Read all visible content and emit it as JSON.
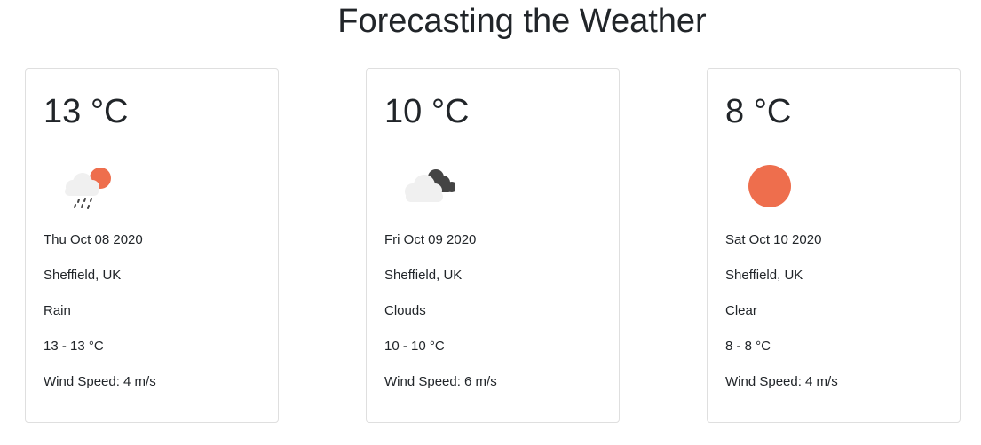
{
  "page": {
    "title": "Forecasting the Weather"
  },
  "colors": {
    "sun": "#ee6e4d",
    "cloud_light": "#f0f0f0",
    "cloud_dark": "#444444",
    "text": "#212529",
    "card_border": "#dfdfdf"
  },
  "cards": [
    {
      "temperature": "13 °C",
      "icon": "rain-cloud-sun-icon",
      "date": "Thu Oct 08 2020",
      "location": "Sheffield, UK",
      "condition": "Rain",
      "range": "13 - 13 °C",
      "wind": "Wind Speed: 4 m/s"
    },
    {
      "temperature": "10 °C",
      "icon": "clouds-icon",
      "date": "Fri Oct 09 2020",
      "location": "Sheffield, UK",
      "condition": "Clouds",
      "range": "10 - 10 °C",
      "wind": "Wind Speed: 6 m/s"
    },
    {
      "temperature": "8 °C",
      "icon": "clear-sun-icon",
      "date": "Sat Oct 10 2020",
      "location": "Sheffield, UK",
      "condition": "Clear",
      "range": "8 - 8 °C",
      "wind": "Wind Speed: 4 m/s"
    }
  ]
}
